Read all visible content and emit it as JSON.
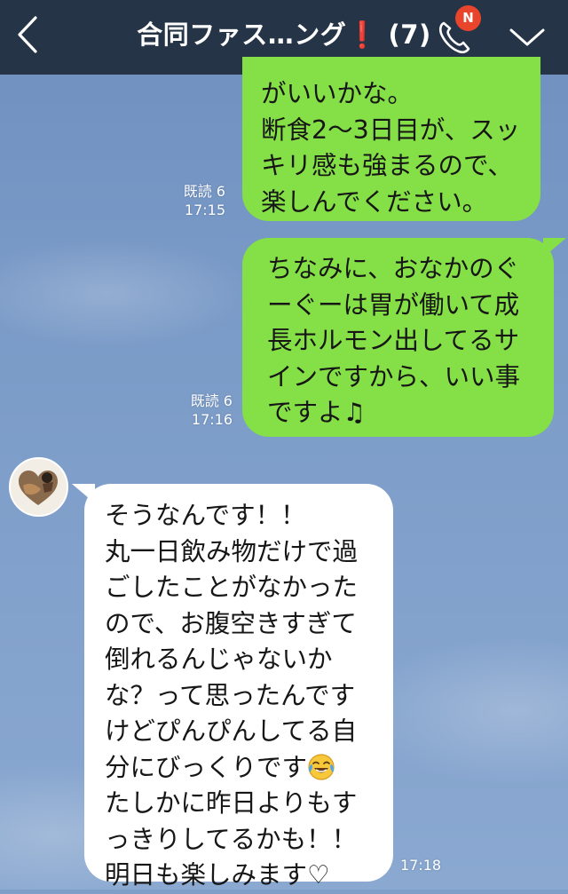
{
  "header": {
    "title": "合同ファス…ング",
    "title_alert": "❗",
    "member_count": "(7)",
    "badge": "N",
    "page_dots": 3,
    "active_dot": 1
  },
  "messages": [
    {
      "side": "out",
      "lines": [
        "がいいかな。",
        "断食2〜3日目が、スッ",
        "キリ感も強まるので、",
        "楽しんでください。"
      ],
      "read": "既読 6",
      "time": "17:15"
    },
    {
      "side": "out",
      "lines": [
        "ちなみに、おなかのぐ",
        "ーぐーは胃が働いて成",
        "長ホルモン出してるサ",
        "インですから、いい事",
        "ですよ♫"
      ],
      "read": "既読 6",
      "time": "17:16"
    },
    {
      "side": "in",
      "lines": [
        "そうなんです！！",
        "丸一日飲み物だけで過",
        "ごしたことがなかった",
        "ので、お腹空きすぎて",
        "倒れるんじゃないか",
        "な？って思ったんです",
        "けどぴんぴんしてる自",
        "分にびっくりです",
        "たしかに昨日よりもす",
        "っきりしてるかも！！",
        "明日も楽しみます♡"
      ],
      "emoji_after_line": 7,
      "emoji": "face-with-tears-of-joy-icon",
      "time": "17:18"
    }
  ],
  "colors": {
    "header_bg": "#253446",
    "outgoing_bubble": "#85df46",
    "incoming_bubble": "#ffffff",
    "badge": "#e8452c",
    "chat_background": "#7f9fc9"
  }
}
